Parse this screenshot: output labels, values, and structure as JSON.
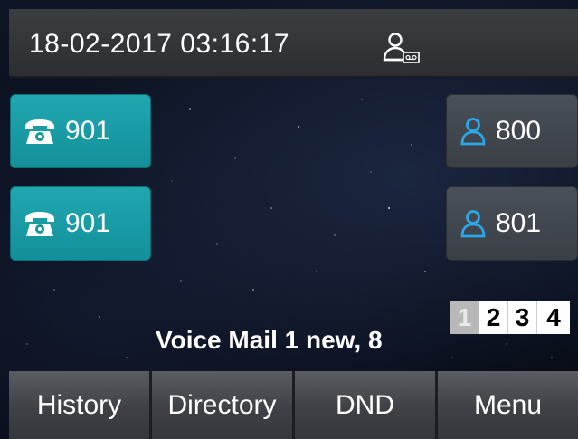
{
  "status_bar": {
    "datetime": "18-02-2017 03:16:17",
    "status_icon": "contact-voicemail-icon"
  },
  "line_keys_left": [
    {
      "label": "901",
      "icon": "phone-icon",
      "color": "#1a9ca6"
    },
    {
      "label": "901",
      "icon": "phone-icon",
      "color": "#1a9ca6"
    }
  ],
  "line_keys_right": [
    {
      "label": "800",
      "icon": "contact-icon",
      "color": "#3a3f46"
    },
    {
      "label": "801",
      "icon": "contact-icon",
      "color": "#3a3f46"
    }
  ],
  "pager": {
    "pages": [
      "1",
      "2",
      "3",
      "4"
    ],
    "active": "1"
  },
  "voicemail": {
    "text": "Voice Mail 1 new, 8"
  },
  "softkeys": {
    "history": "History",
    "directory": "Directory",
    "dnd": "DND",
    "menu": "Menu"
  },
  "colors": {
    "accent_teal": "#1a9ca6",
    "contact_blue": "#2aa8e8",
    "background": "#0a0f1c"
  }
}
